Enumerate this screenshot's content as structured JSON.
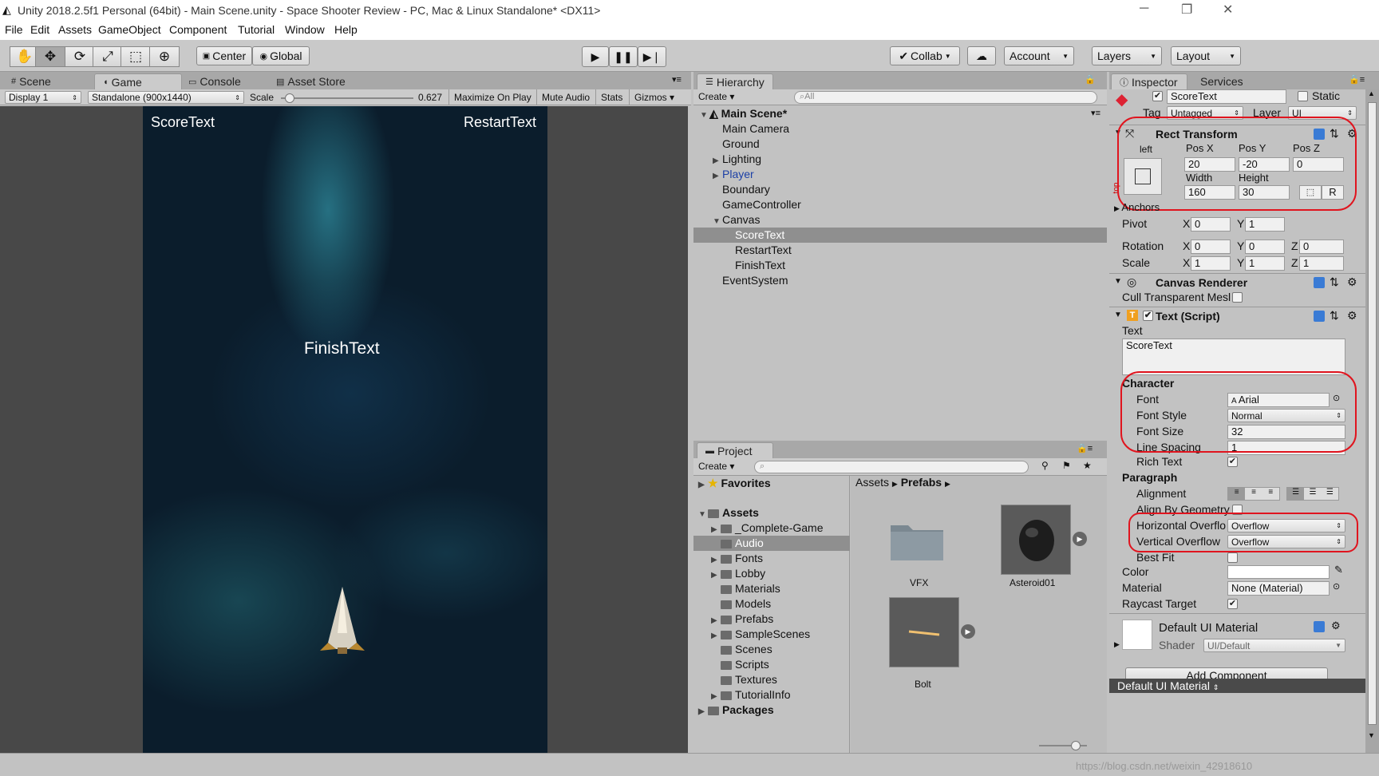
{
  "window": {
    "title": "Unity 2018.2.5f1 Personal (64bit) - Main Scene.unity - Space Shooter Review - PC, Mac & Linux Standalone* <DX11>"
  },
  "menu": [
    "File",
    "Edit",
    "Assets",
    "GameObject",
    "Component",
    "Tutorial",
    "Window",
    "Help"
  ],
  "toolbar": {
    "center": "Center",
    "global": "Global",
    "collab": "Collab",
    "account": "Account",
    "layers": "Layers",
    "layout": "Layout"
  },
  "game_panel": {
    "tabs": {
      "scene": "Scene",
      "game": "Game",
      "console": "Console",
      "asset_store": "Asset Store"
    },
    "display": "Display 1",
    "resolution": "Standalone (900x1440)",
    "scale_label": "Scale",
    "scale_value": "0.627",
    "maximize": "Maximize On Play",
    "mute": "Mute Audio",
    "stats": "Stats",
    "gizmos": "Gizmos",
    "texts": {
      "score": "ScoreText",
      "restart": "RestartText",
      "finish": "FinishText"
    },
    "scale_fraction": 0.03
  },
  "hierarchy": {
    "tab": "Hierarchy",
    "create": "Create",
    "search_placeholder": "All",
    "scene": "Main Scene*",
    "items": [
      {
        "label": "Main Camera"
      },
      {
        "label": "Ground"
      },
      {
        "label": "Lighting"
      },
      {
        "label": "Player"
      },
      {
        "label": "Boundary"
      },
      {
        "label": "GameController"
      },
      {
        "label": "Canvas"
      },
      {
        "label": "ScoreText"
      },
      {
        "label": "RestartText"
      },
      {
        "label": "FinishText"
      },
      {
        "label": "EventSystem"
      }
    ]
  },
  "project": {
    "tab": "Project",
    "create": "Create",
    "favorites": "Favorites",
    "assets": "Assets",
    "packages": "Packages",
    "folders": [
      "_Complete-Game",
      "Audio",
      "Fonts",
      "Lobby",
      "Materials",
      "Models",
      "Prefabs",
      "SampleScenes",
      "Scenes",
      "Scripts",
      "Textures",
      "TutorialInfo"
    ],
    "breadcrumb": {
      "assets": "Assets",
      "prefabs": "Prefabs"
    },
    "items": [
      {
        "label": "VFX"
      },
      {
        "label": "Asteroid01"
      },
      {
        "label": "Bolt"
      }
    ]
  },
  "inspector": {
    "tabs": {
      "inspector": "Inspector",
      "services": "Services"
    },
    "object_name": "ScoreText",
    "static_label": "Static",
    "tag_label": "Tag",
    "tag_value": "Untagged",
    "layer_label": "Layer",
    "layer_value": "UI",
    "rect": {
      "title": "Rect Transform",
      "anchor_h": "left",
      "anchor_v": "top",
      "posx_label": "Pos X",
      "posy_label": "Pos Y",
      "posz_label": "Pos Z",
      "posx": "20",
      "posy": "-20",
      "posz": "0",
      "width_label": "Width",
      "height_label": "Height",
      "width": "160",
      "height": "30",
      "r_button": "R",
      "anchors": "Anchors",
      "pivot": "Pivot",
      "pivot_x": "0",
      "pivot_y": "1",
      "rotation": "Rotation",
      "rot_x": "0",
      "rot_y": "0",
      "rot_z": "0",
      "scale": "Scale",
      "scale_x": "1",
      "scale_y": "1",
      "scale_z": "1",
      "x": "X",
      "y": "Y",
      "z": "Z"
    },
    "canvas_renderer": {
      "title": "Canvas Renderer",
      "cull": "Cull Transparent Mesl"
    },
    "text_script": {
      "title": "Text (Script)",
      "text_label": "Text",
      "text_value": "ScoreText",
      "character": "Character",
      "font_label": "Font",
      "font_value": "Arial",
      "style_label": "Font Style",
      "style_value": "Normal",
      "size_label": "Font Size",
      "size_value": "32",
      "spacing_label": "Line Spacing",
      "spacing_value": "1",
      "rich_text": "Rich Text",
      "paragraph": "Paragraph",
      "alignment": "Alignment",
      "align_geometry": "Align By Geometry",
      "h_overflow_label": "Horizontal Overflo",
      "h_overflow_value": "Overflow",
      "v_overflow_label": "Vertical Overflow",
      "v_overflow_value": "Overflow",
      "best_fit": "Best Fit",
      "color": "Color",
      "material_label": "Material",
      "material_value": "None (Material)",
      "raycast": "Raycast Target"
    },
    "material": {
      "title": "Default UI Material",
      "shader_label": "Shader",
      "shader_value": "UI/Default"
    },
    "add_component": "Add Component",
    "bottom_label": "Default UI Material"
  },
  "watermark": "https://blog.csdn.net/weixin_42918610"
}
